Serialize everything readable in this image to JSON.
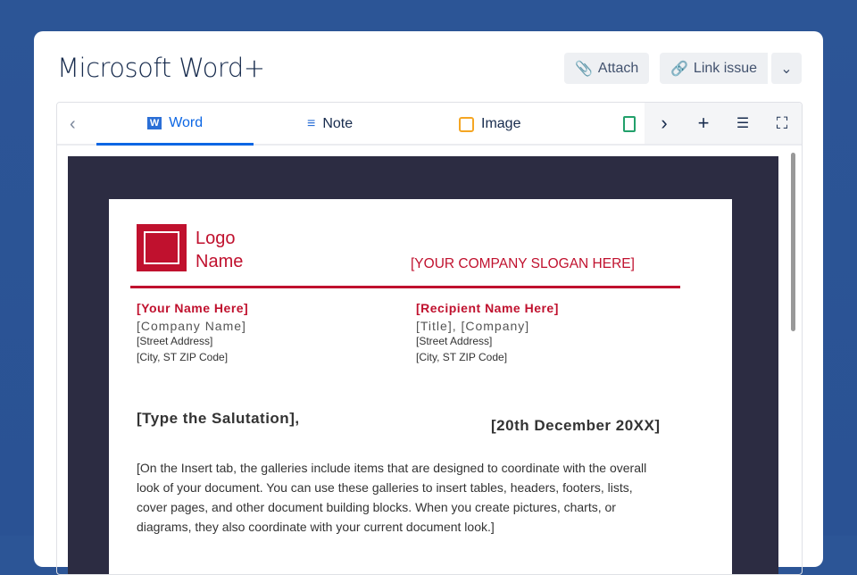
{
  "window": {
    "title": "Microsoft Word+"
  },
  "actions": {
    "attach": "Attach",
    "link_issue": "Link issue"
  },
  "tabs": [
    {
      "label": "Word"
    },
    {
      "label": "Note"
    },
    {
      "label": "Image"
    }
  ],
  "document": {
    "logo_line1": "Logo",
    "logo_line2": "Name",
    "slogan": "[YOUR COMPANY SLOGAN HERE]",
    "sender": {
      "name": "[Your Name Here]",
      "company": "[Company Name]",
      "street": "[Street Address]",
      "city": "[City, ST ZIP Code]"
    },
    "recipient": {
      "name": "[Recipient Name Here]",
      "company": "[Title], [Company]",
      "street": "[Street Address]",
      "city": "[City, ST ZIP Code]"
    },
    "salutation": "[Type the Salutation],",
    "date": "[20th December 20XX]",
    "body": "[On the Insert tab, the galleries include items that are designed to coordinate with the overall look of your document. You can use these galleries to insert tables, headers, footers, lists, cover pages, and other document building blocks. When you create pictures, charts, or diagrams, they also coordinate with your current document look.]"
  }
}
